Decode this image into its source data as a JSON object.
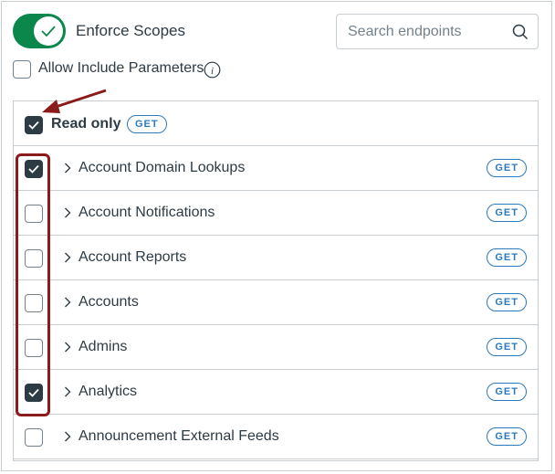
{
  "enforce": {
    "label": "Enforce Scopes",
    "enabled": true
  },
  "search": {
    "placeholder": "Search endpoints"
  },
  "allow_include": {
    "label": "Allow Include Parameters",
    "checked": false
  },
  "read_only": {
    "label": "Read only",
    "badge": "GET",
    "checked": true
  },
  "endpoints": [
    {
      "name": "Account Domain Lookups",
      "badge": "GET",
      "checked": true
    },
    {
      "name": "Account Notifications",
      "badge": "GET",
      "checked": false
    },
    {
      "name": "Account Reports",
      "badge": "GET",
      "checked": false
    },
    {
      "name": "Accounts",
      "badge": "GET",
      "checked": false
    },
    {
      "name": "Admins",
      "badge": "GET",
      "checked": false
    },
    {
      "name": "Analytics",
      "badge": "GET",
      "checked": true
    },
    {
      "name": "Announcement External Feeds",
      "badge": "GET",
      "checked": false
    }
  ],
  "colors": {
    "toggle_on": "#0b874b",
    "badge": "#2b7abc",
    "checkbox_checked": "#2d3b45",
    "annotation": "#8b1b1b"
  }
}
